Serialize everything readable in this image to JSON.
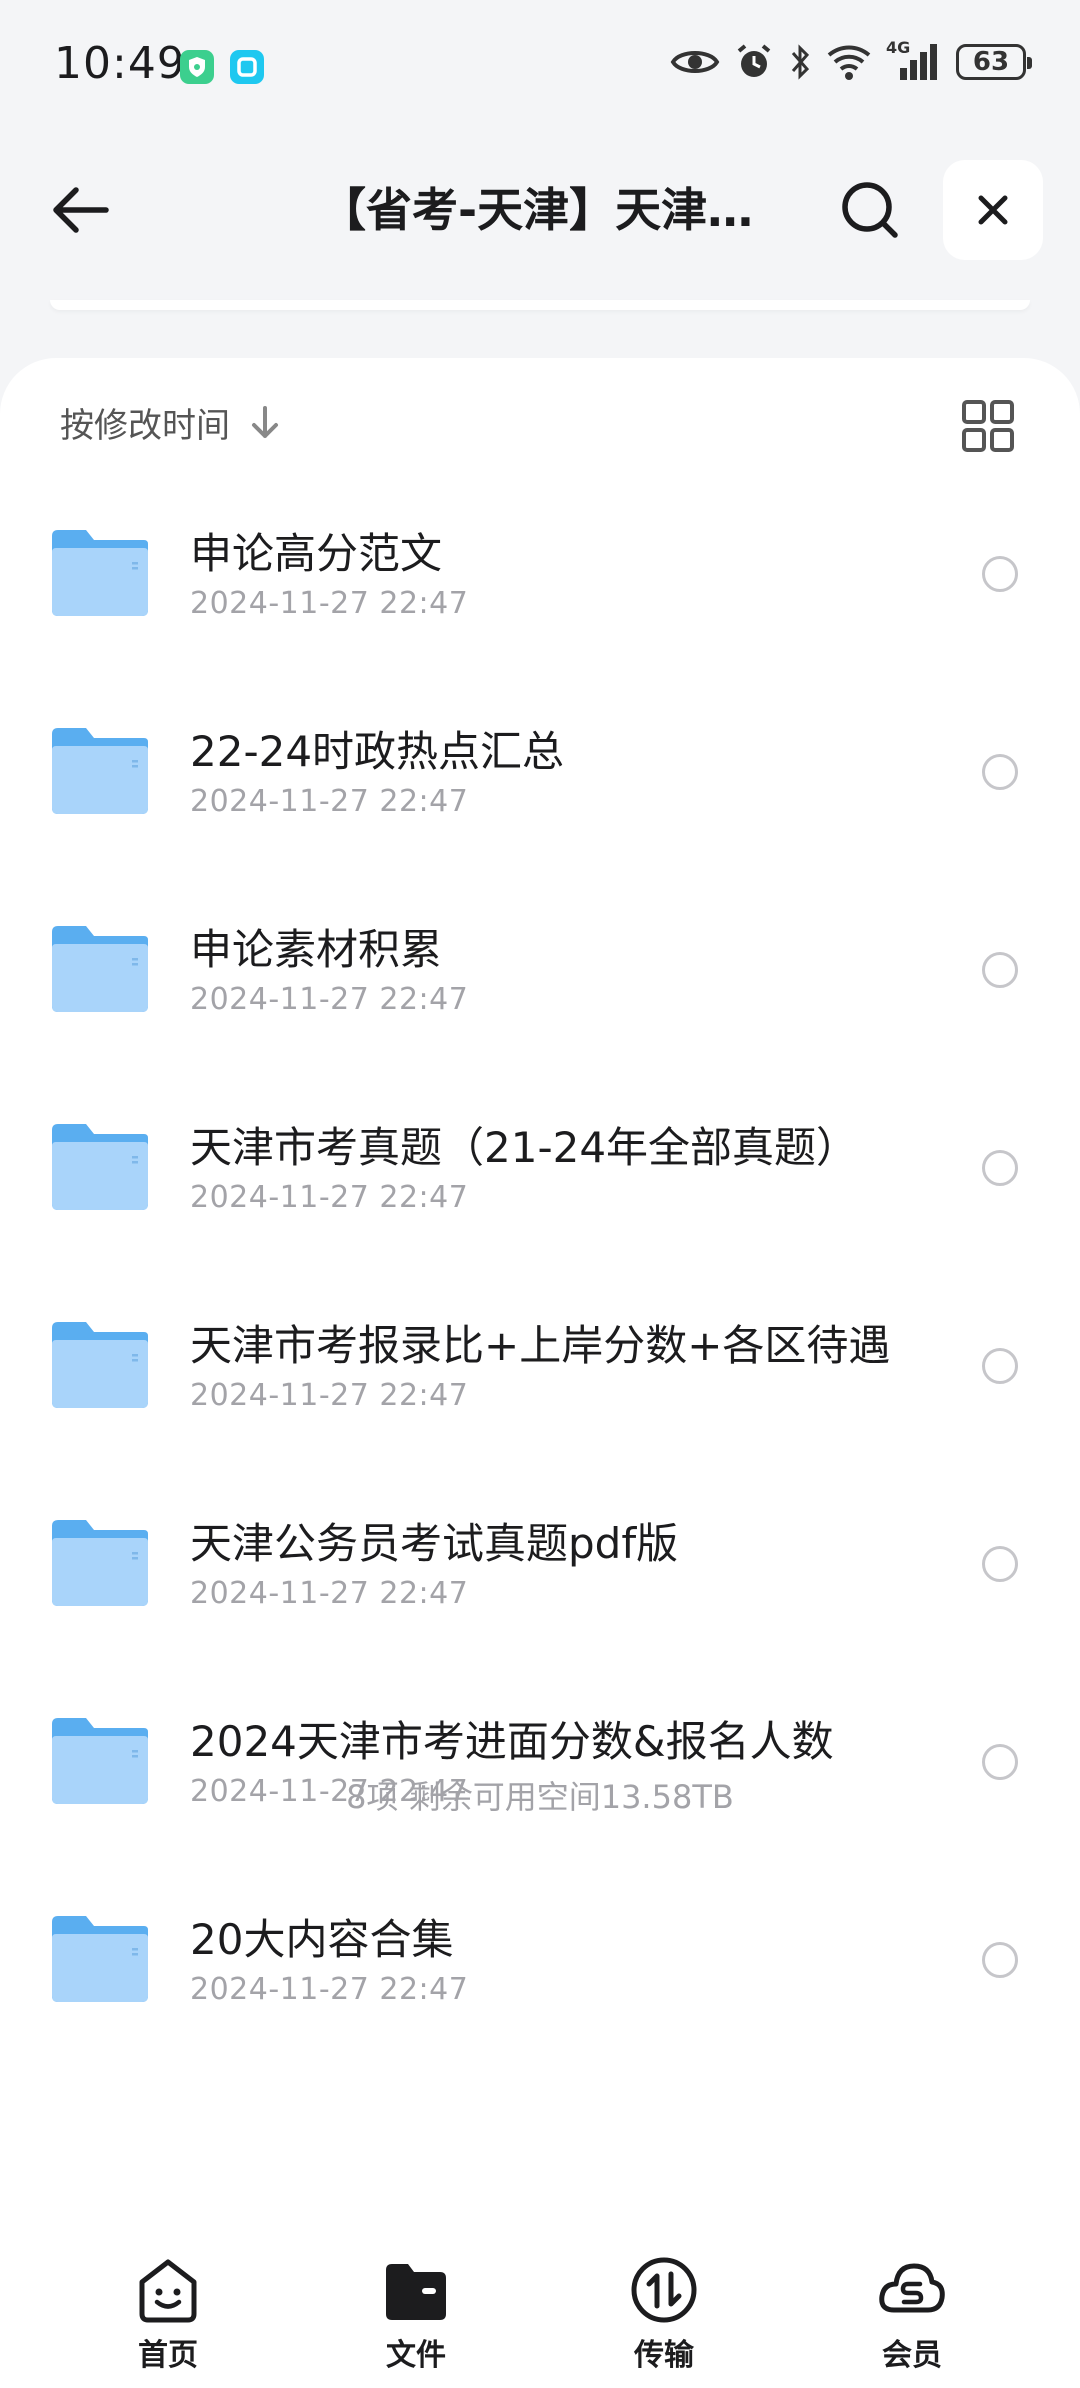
{
  "status_bar": {
    "time": "10:49",
    "network": "4G",
    "battery": "63"
  },
  "header": {
    "title": "【省考-天津】天津…"
  },
  "sort": {
    "label": "按修改时间"
  },
  "files": [
    {
      "name": "申论高分范文",
      "date": "2024-11-27 22:47"
    },
    {
      "name": "22-24时政热点汇总",
      "date": "2024-11-27 22:47"
    },
    {
      "name": "申论素材积累",
      "date": "2024-11-27 22:47"
    },
    {
      "name": "天津市考真题（21-24年全部真题）",
      "date": "2024-11-27 22:47"
    },
    {
      "name": "天津市考报录比+上岸分数+各区待遇",
      "date": "2024-11-27 22:47"
    },
    {
      "name": "天津公务员考试真题pdf版",
      "date": "2024-11-27 22:47"
    },
    {
      "name": "2024天津市考进面分数&报名人数",
      "date": "2024-11-27 22:47"
    },
    {
      "name": "20大内容合集",
      "date": "2024-11-27 22:47"
    }
  ],
  "summary": "8项 剩余可用空间13.58TB",
  "nav": [
    {
      "label": "首页"
    },
    {
      "label": "文件"
    },
    {
      "label": "传输"
    },
    {
      "label": "会员"
    }
  ],
  "colors": {
    "folder": "#5aaef0",
    "background": "#f4f5f7",
    "accent_green": "#3ccf8e",
    "accent_cyan": "#1ec8f0"
  }
}
